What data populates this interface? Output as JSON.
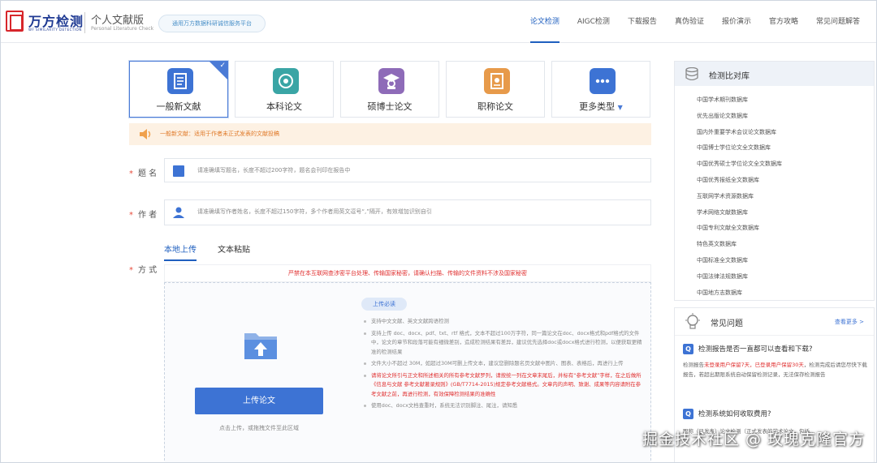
{
  "header": {
    "brand": "万方检测",
    "brand_sub": "WF SIMILARITY DETECTION",
    "edition": "个人文献版",
    "edition_sub": "Personal Literature Check",
    "pill": "通用万方数据科研诚信服务平台",
    "nav": [
      "论文检测",
      "AIGC检测",
      "下载报告",
      "真伪验证",
      "报价演示",
      "官方攻略",
      "常见问题解答"
    ],
    "active_nav": 0,
    "brand_color": "#1f3a93",
    "logo_color": "#d7262b"
  },
  "doc_types": [
    {
      "label": "一般新文献",
      "icon": "document-icon",
      "color": "#3d73d4",
      "selected": true
    },
    {
      "label": "本科论文",
      "icon": "graduation-icon",
      "color": "#3aa5a5"
    },
    {
      "label": "硕博士论文",
      "icon": "doctor-cap-icon",
      "color": "#8e6bb8"
    },
    {
      "label": "职称论文",
      "icon": "certificate-icon",
      "color": "#e79a4a"
    },
    {
      "label": "更多类型",
      "icon": "more-icon",
      "color": "#3d73d4",
      "caret": "▼"
    }
  ],
  "notice": {
    "text": "一般新文献：适用于作者未正式发表的文献投稿"
  },
  "form": {
    "title_label": "题 名",
    "title_placeholder": "请准确填写题名，长度不超过200字符，题名会刊印在报告中",
    "author_label": "作 者",
    "author_placeholder": "请准确填写作者姓名，长度不超过150字符，多个作者用英文逗号“,”隔开，有效增加识别自引",
    "method_label": "方 式",
    "required_mark": "*"
  },
  "upload_tabs": [
    "本地上传",
    "文本粘贴"
  ],
  "active_tab": 0,
  "upload": {
    "warning": "严禁在本互联网查涉密平台处理、传输国家秘密，请确认扫描、传输的文件资料不涉及国家秘密",
    "button": "上传论文",
    "hint": "点击上传，或拖拽文件至此区域",
    "requirements_tag": "上传必读",
    "requirements": [
      {
        "text": "支持中文文献、英文文献跨语检测",
        "red": false
      },
      {
        "text": "支持上传 doc、docx、pdf、txt、rtf 格式，文本不超过100万字符，同一篇论文在doc、docx格式和pdf格式的文件中，论文的章节和段落可能有细微差别，造成检测结果有差异，建议优先选择doc或docx格式进行检测，以便获取更精准的检测结果",
        "red": false
      },
      {
        "text": "文件大小不超过 30M，如超过30M可删上传文本，建议您删除题名页文献中图片、图表、表格后，再进行上传",
        "red": false
      },
      {
        "text": "请将论文所引与正文和所述相关的所有参考文献罗列，请按统一列在文章末尾后，并标有“参考文献”字样，在之后做所《信息与文献 参考文献著录规则》(GB/T7714-2015)规定参考文献格式。文章内的声明、致谢、成果等内容请附在参考文献之前，再进行检测，有效保障检测结果的准确性",
        "red": true
      },
      {
        "text": "使用doc、docx文档查重时，系统无法识别脚注、尾注，请知悉",
        "red": false
      }
    ]
  },
  "sidebar": {
    "db_title": "检测比对库",
    "databases": [
      "中国学术期刊数据库",
      "优先出版论文数据库",
      "国内外重要学术会议论文数据库",
      "中国博士学位论文全文数据库",
      "中国优秀硕士学位论文全文数据库",
      "中国优秀报纸全文数据库",
      "互联网学术资源数据库",
      "学术网络文献数据库",
      "中国专利文献全文数据库",
      "特色英文数据库",
      "中国标准全文数据库",
      "中国法律法规数据库",
      "中国地方志数据库"
    ],
    "faq_title": "常见问题",
    "faq_more": "查看更多 >",
    "faq": [
      {
        "q": "检测报告是否一直都可以查看和下载?",
        "a_pre": "检测报告",
        "a_hl": "未登录用户保留7天，已登录用户保留30天",
        "a_post": "，检测完成后请您尽快下载报告，若超出期限系统自动保留检测记录，无法保存检测报告"
      },
      {
        "q": "检测系统如何收取费用?",
        "a_pre": "",
        "a_hl": "",
        "a_post": "职称（已发表）论文检测（正式发表的学术论文，包括..."
      }
    ]
  },
  "watermark": "掘金技术社区 @ 玫瑰克隆官方"
}
